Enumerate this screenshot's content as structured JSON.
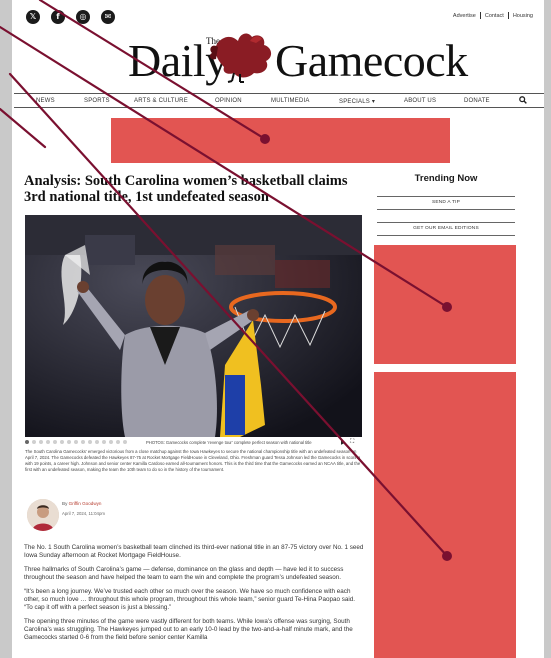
{
  "topbar": {
    "social": [
      {
        "icon": "twitter-icon",
        "glyph": "𝕏"
      },
      {
        "icon": "facebook-icon",
        "glyph": "f"
      },
      {
        "icon": "instagram-icon",
        "glyph": "◎"
      },
      {
        "icon": "email-icon",
        "glyph": "✉"
      }
    ],
    "links": [
      "Advertise",
      "Contact",
      "Housing"
    ]
  },
  "logo": {
    "the": "The",
    "word1": "Daily",
    "word2": "Gamecock"
  },
  "nav": {
    "items": [
      "NEWS",
      "SPORTS",
      "ARTS & CULTURE",
      "OPINION",
      "MULTIMEDIA",
      "SPECIALS ▾",
      "ABOUT US",
      "DONATE"
    ],
    "search_icon": "search-icon"
  },
  "article": {
    "headline": "Analysis: South Carolina women’s basketball claims 3rd national title, 1st undefeated season",
    "photo_credit": "PHOTOS: Gamecocks complete ‘revenge tour’ complete perfect season with national title",
    "caption": "The South Carolina Gamecocks’ emerged victorious from a close matchup against the Iowa Hawkeyes to secure the national championship title with an undefeated season on April 7, 2024. The Gamecocks defeated the Hawkeyes 87-75 at Rocket Mortgage FieldHouse in Cleveland, Ohio. Freshman guard Tessa Johnson led the Gamecocks in scoring with 19 points, a career high. Johnson and senior center Kamilla Cardoso earned all-tournament honors. This is the third time that the Gamecocks earned an NCAA title, and the first with an undefeated season, making the team the 10th team to do so in the history of the tournament.",
    "author_prefix": "By ",
    "author": "Griffin Goodwyn",
    "date": "April 7, 2024, 11:04pm",
    "paragraphs": [
      "The No. 1 South Carolina women’s basketball team clinched its third-ever national title in an 87-75 victory over No. 1 seed Iowa Sunday afternoon at Rocket Mortgage FieldHouse.",
      "Three hallmarks of South Carolina’s game — defense, dominance on the glass and depth — have led it to success throughout the season and have helped the team to earn the win and complete the program’s undefeated season.",
      "“It’s been a long journey. We’ve trusted each other so much over the season. We have so much confidence with each other, so much love … throughout this whole program, throughout this whole team,” senior guard Te-Hina Paopao said. “To cap it off with a perfect season is just a blessing.”",
      "The opening three minutes of the game were vastly different for both teams. While Iowa’s offense was surging, South Carolina’s was struggling. The Hawkeyes jumped out to an early 10-0 lead by the two-and-a-half minute mark, and the Gamecocks started 0-6 from the field before senior center Kamilla"
    ]
  },
  "sidebar": {
    "title": "Trending Now",
    "tip": "SEND A TIP",
    "email": "GET OUR EMAIL EDITIONS"
  },
  "colors": {
    "ad": "#e25552",
    "arrow": "#7a1030",
    "logo_bird": "#8a1c24"
  }
}
